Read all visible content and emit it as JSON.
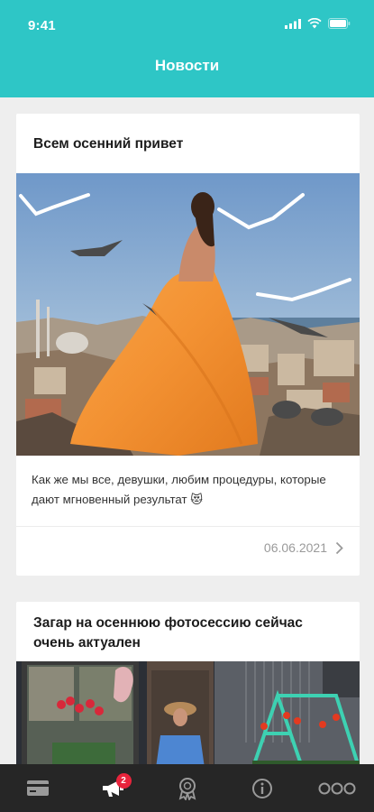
{
  "status_bar": {
    "time": "9:41"
  },
  "header": {
    "title": "Новости"
  },
  "news": [
    {
      "title": "Всем осенний привет",
      "text": "Как же мы все, девушки, любим процедуры, которые дают мгновенный результат 😻",
      "date": "06.06.2021"
    },
    {
      "title": "Загар на осеннюю фотосессию сейчас очень актуален"
    }
  ],
  "tabbar": {
    "tabs": [
      {
        "icon": "card-icon"
      },
      {
        "icon": "megaphone-icon",
        "badge": "2",
        "active": true
      },
      {
        "icon": "award-icon"
      },
      {
        "icon": "info-icon"
      },
      {
        "icon": "more-icon"
      }
    ]
  },
  "colors": {
    "accent": "#2ec6c6",
    "tabbar": "#262626",
    "badge": "#e8243c"
  }
}
